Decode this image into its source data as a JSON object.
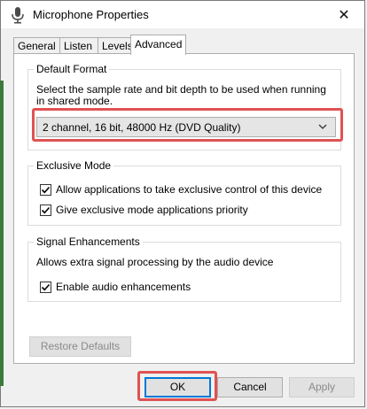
{
  "window": {
    "title": "Microphone Properties",
    "close_glyph": "✕"
  },
  "tabs": [
    {
      "label": "General"
    },
    {
      "label": "Listen"
    },
    {
      "label": "Levels"
    },
    {
      "label": "Advanced",
      "active": true
    }
  ],
  "default_format": {
    "legend": "Default Format",
    "description_line1": "Select the sample rate and bit depth to be used when running",
    "description_line2": "in shared mode.",
    "selected_value": "2 channel, 16 bit, 48000 Hz (DVD Quality)"
  },
  "exclusive_mode": {
    "legend": "Exclusive Mode",
    "allow_control_label": "Allow applications to take exclusive control of this device",
    "allow_control_checked": true,
    "priority_label": "Give exclusive mode applications priority",
    "priority_checked": true
  },
  "signal_enhancements": {
    "legend": "Signal Enhancements",
    "description": "Allows extra signal processing by the audio device",
    "enable_label": "Enable audio enhancements",
    "enable_checked": true
  },
  "buttons": {
    "restore_defaults": "Restore Defaults",
    "ok": "OK",
    "cancel": "Cancel",
    "apply": "Apply"
  },
  "colors": {
    "highlight": "#e05252",
    "focus": "#0078d7"
  }
}
